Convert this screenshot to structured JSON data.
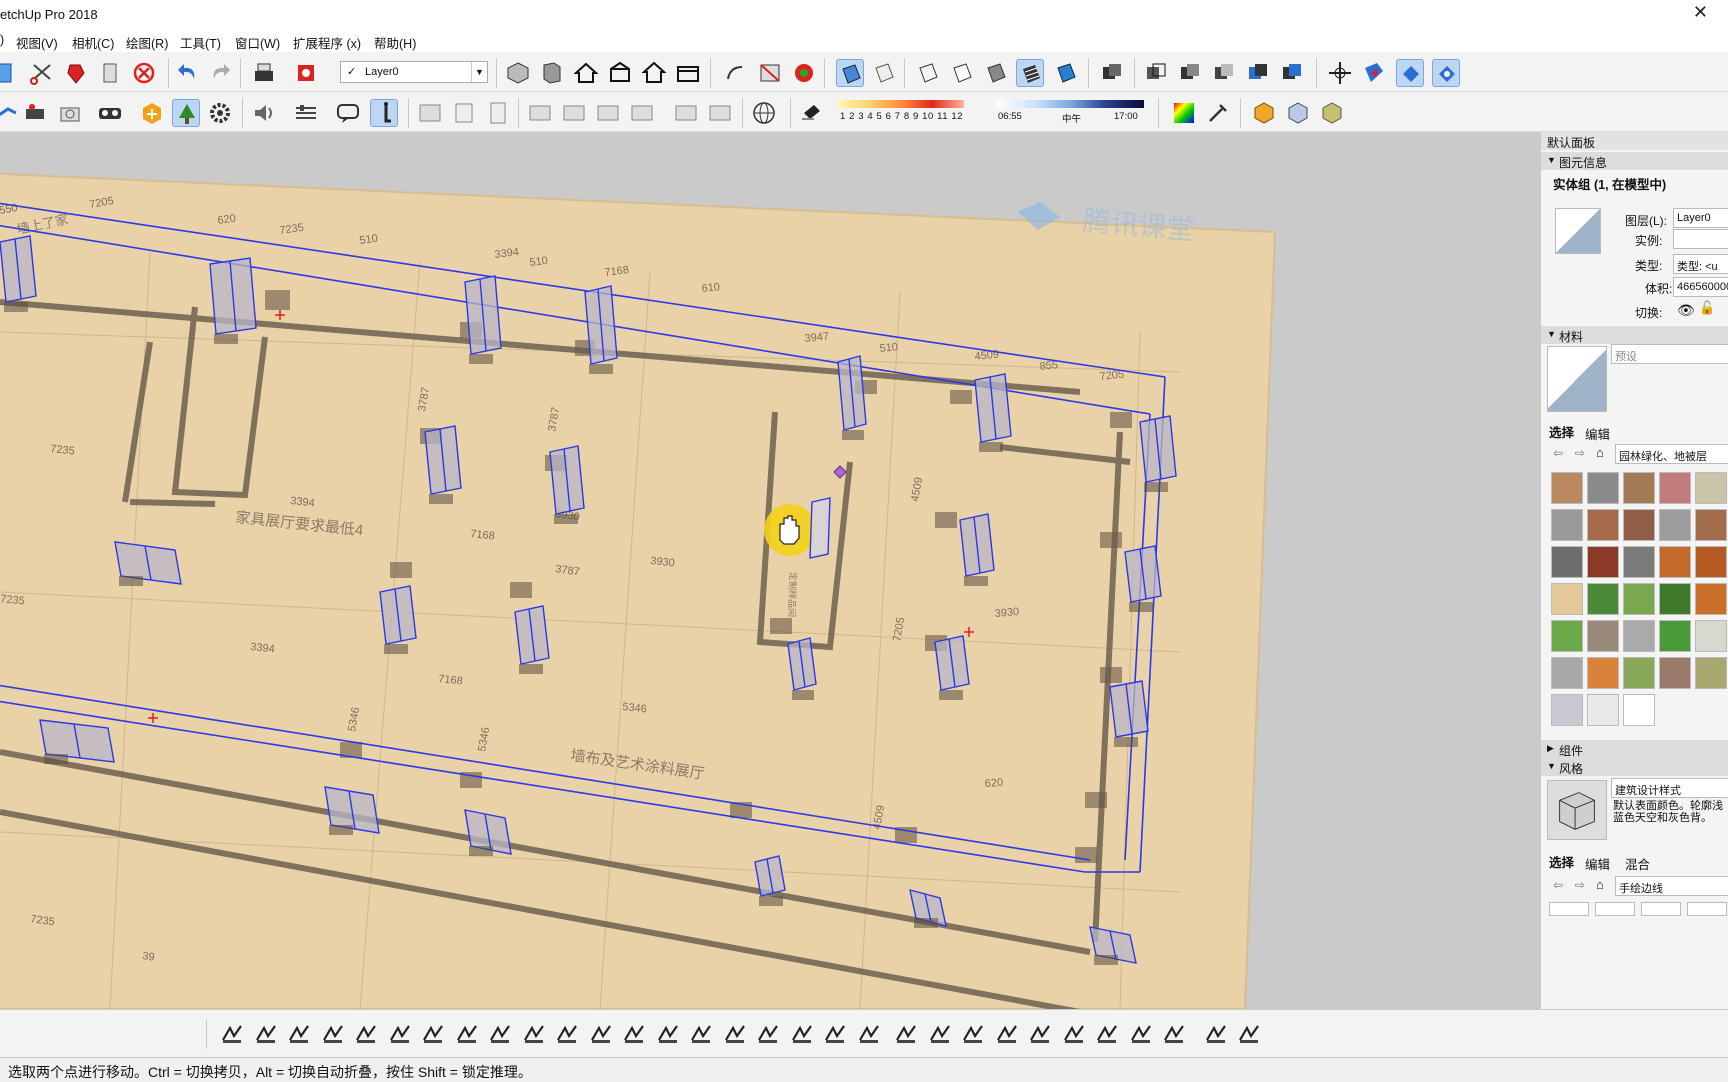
{
  "window": {
    "title": "etchUp Pro 2018",
    "close_glyph": "✕"
  },
  "menu": [
    {
      "label": ")"
    },
    {
      "label": "视图(V)"
    },
    {
      "label": "相机(C)"
    },
    {
      "label": "绘图(R)"
    },
    {
      "label": "工具(T)"
    },
    {
      "label": "窗口(W)"
    },
    {
      "label": "扩展程序 (x)"
    },
    {
      "label": "帮助(H)"
    }
  ],
  "toolbar": {
    "layer_check": "✓",
    "layer_value": "Layer0",
    "shadow_months": "1 2 3 4 5 6 7 8 9 10 11 12",
    "shadow_time_start": "06:55",
    "shadow_time_mid": "中午",
    "shadow_time_end": "17:00"
  },
  "canvas": {
    "watermark": "腾讯课堂",
    "plan_texts": {
      "room1": "家具展厅要求最低4",
      "room2": "墙布及艺术涂料展厅",
      "sign": "定制样品间",
      "corner": "墙上了家"
    },
    "dims": [
      "7205",
      "620",
      "7235",
      "510",
      "3394",
      "510",
      "7168",
      "610",
      "3947",
      "510",
      "4509",
      "855",
      "7205",
      "7235",
      "3394",
      "7168",
      "3930",
      "3930",
      "3787",
      "3787",
      "3787",
      "4509",
      "3930",
      "7205",
      "7235",
      "3394",
      "7168",
      "5346",
      "5346",
      "5346",
      "4509",
      "620",
      "7235",
      "39",
      "550"
    ]
  },
  "panel": {
    "title": "默认面板",
    "entity_info": {
      "header": "图元信息",
      "entity_type": "实体组 (1, 在模型中)",
      "layer_label": "图层(L):",
      "layer_value": "Layer0",
      "instance_label": "实例:",
      "instance_value": "",
      "type_label": "类型:",
      "type_value": "类型: <u",
      "volume_label": "体积:",
      "volume_value": "466560000",
      "toggle_label": "切换:"
    },
    "materials": {
      "header": "材料",
      "default_name": "预设",
      "tab_select": "选择",
      "tab_edit": "编辑",
      "library": "园林绿化、地被层"
    },
    "components": {
      "header": "组件"
    },
    "styles": {
      "header": "风格",
      "style_name": "建筑设计样式",
      "style_desc": "默认表面颜色。轮廓浅蓝色天空和灰色背。",
      "tab_select": "选择",
      "tab_edit": "编辑",
      "tab_mix": "混合",
      "collection": "手绘边线"
    }
  },
  "status": {
    "message": "选取两个点进行移动。Ctrl = 切换拷贝，Alt = 切换自动折叠，按住 Shift = 锁定推理。"
  },
  "colors": {
    "accent_blue": "#2b39e8",
    "paper": "#e7cfa6",
    "selection": "#bcd6f4"
  }
}
